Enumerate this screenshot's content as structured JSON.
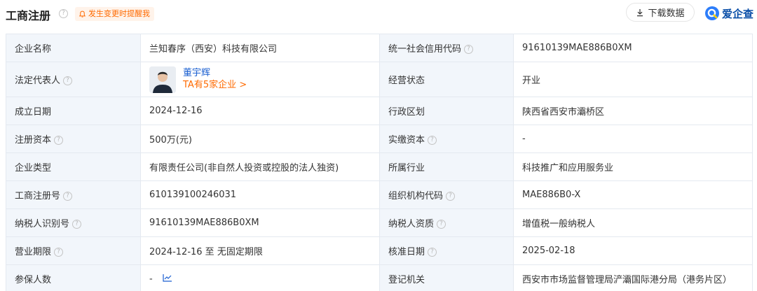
{
  "header": {
    "title": "工商注册",
    "remind_label": "发生变更时提醒我",
    "download_label": "下载数据",
    "brand_name": "爱企查"
  },
  "colors": {
    "label_bg": "#f2f6fb",
    "border": "#e4e9f0",
    "accent_orange": "#ff6a00",
    "link_blue": "#1a5fd1",
    "brand_blue": "#0a4fa8"
  },
  "rows": [
    {
      "l1": "企业名称",
      "v1": "兰知春序（西安）科技有限公司",
      "l2": "统一社会信用代码",
      "v2": "91610139MAE886B0XM"
    },
    {
      "l1": "法定代表人",
      "rep_name": "董宇辉",
      "rep_link": "TA有5家企业 >",
      "l2": "经营状态",
      "v2": "开业"
    },
    {
      "l1": "成立日期",
      "v1": "2024-12-16",
      "l2": "行政区划",
      "v2": "陕西省西安市灞桥区"
    },
    {
      "l1": "注册资本",
      "v1": "500万(元)",
      "l2": "实缴资本",
      "v2": "-"
    },
    {
      "l1": "企业类型",
      "v1": "有限责任公司(非自然人投资或控股的法人独资)",
      "l2": "所属行业",
      "v2": "科技推广和应用服务业"
    },
    {
      "l1": "工商注册号",
      "v1": "610139100246031",
      "l2": "组织机构代码",
      "v2": "MAE886B0-X"
    },
    {
      "l1": "纳税人识别号",
      "v1": "91610139MAE886B0XM",
      "l2": "纳税人资质",
      "v2": "增值税一般纳税人"
    },
    {
      "l1": "营业期限",
      "v1": "2024-12-16 至 无固定期限",
      "l2": "核准日期",
      "v2": "2025-02-18"
    },
    {
      "l1": "参保人数",
      "v1": "-",
      "l2": "登记机关",
      "v2": "西安市市场监督管理局浐灞国际港分局（港务片区）"
    }
  ],
  "icons": {
    "help": "question-circle-icon",
    "bell": "bell-icon",
    "download": "download-icon",
    "brand": "brand-logo-icon",
    "trend": "trend-chart-icon"
  }
}
